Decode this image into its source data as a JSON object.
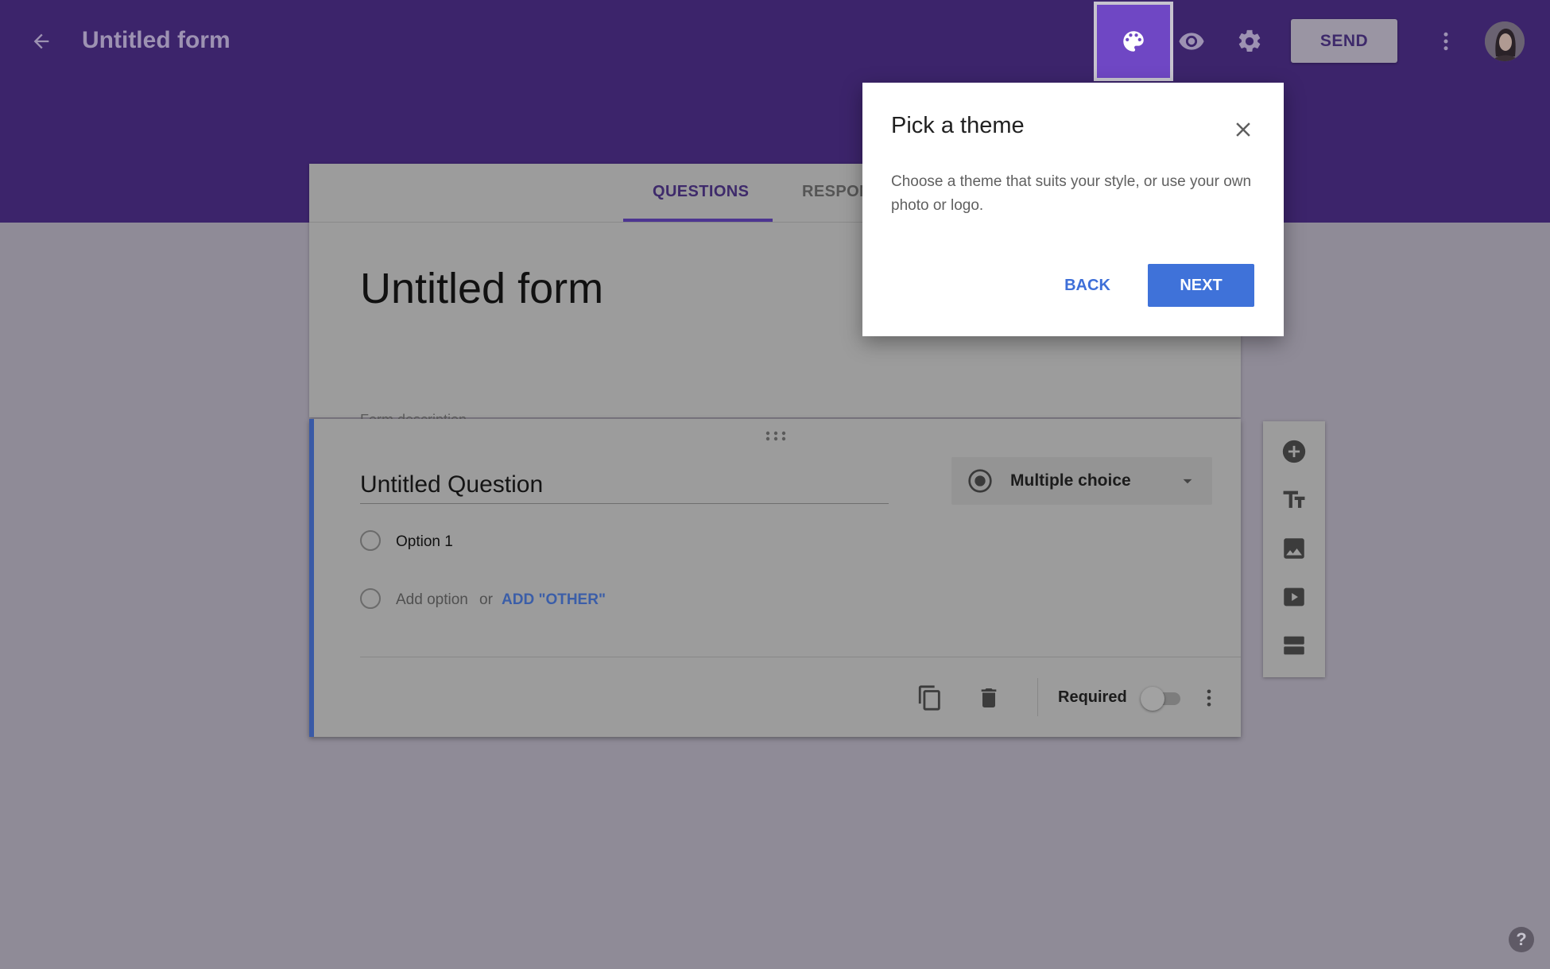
{
  "header": {
    "title": "Untitled form",
    "send_label": "SEND",
    "icons": [
      "back-arrow-icon",
      "palette-icon",
      "eye-icon",
      "gear-icon",
      "more-vert-icon"
    ]
  },
  "tabs": [
    {
      "label": "QUESTIONS",
      "active": true
    },
    {
      "label": "RESPON"
    }
  ],
  "form": {
    "title": "Untitled form",
    "description_placeholder": "Form description"
  },
  "question": {
    "title": "Untitled Question",
    "type": "Multiple choice",
    "options": [
      {
        "label": "Option 1"
      }
    ],
    "add_option": "Add option",
    "or": "or",
    "add_other": "ADD \"OTHER\"",
    "required_label": "Required",
    "required": false
  },
  "sidebar": {
    "icons": [
      "add-question-icon",
      "title-text-icon",
      "image-icon",
      "video-icon",
      "section-icon"
    ]
  },
  "dialog": {
    "title": "Pick a theme",
    "body": "Choose a theme that suits your style, or use your own photo or logo.",
    "back_label": "BACK",
    "next_label": "NEXT"
  },
  "help": "?",
  "colors": {
    "header": "#3c246b",
    "accent": "#3f72d9",
    "palette_active": "#6f47c4",
    "question_accent": "#3a5aa6"
  }
}
